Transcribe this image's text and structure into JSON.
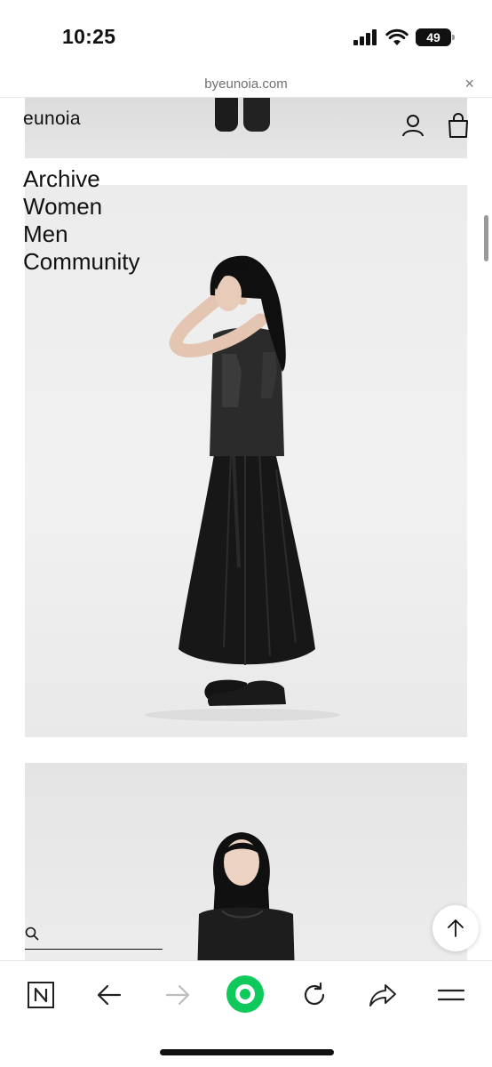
{
  "status_bar": {
    "time": "10:25",
    "battery_percent": "49",
    "battery_level": 0.49
  },
  "browser": {
    "url": "byeunoia.com",
    "close_symbol": "×"
  },
  "site": {
    "logo": "eunoia",
    "nav_items": [
      "Archive",
      "Women",
      "Men",
      "Community"
    ]
  },
  "icons": {
    "account": "user-icon",
    "cart": "shopping-bag-icon",
    "search": "search-icon",
    "scroll_top": "arrow-up-icon",
    "toolbar": [
      "n-home-icon",
      "back-arrow-icon",
      "forward-arrow-icon",
      "green-dot-icon",
      "refresh-icon",
      "share-icon",
      "menu-icon"
    ]
  },
  "colors": {
    "accent_green": "#10c95b",
    "text": "#111111",
    "url_text": "#6f6f6f",
    "disabled": "#bdbdbd"
  }
}
